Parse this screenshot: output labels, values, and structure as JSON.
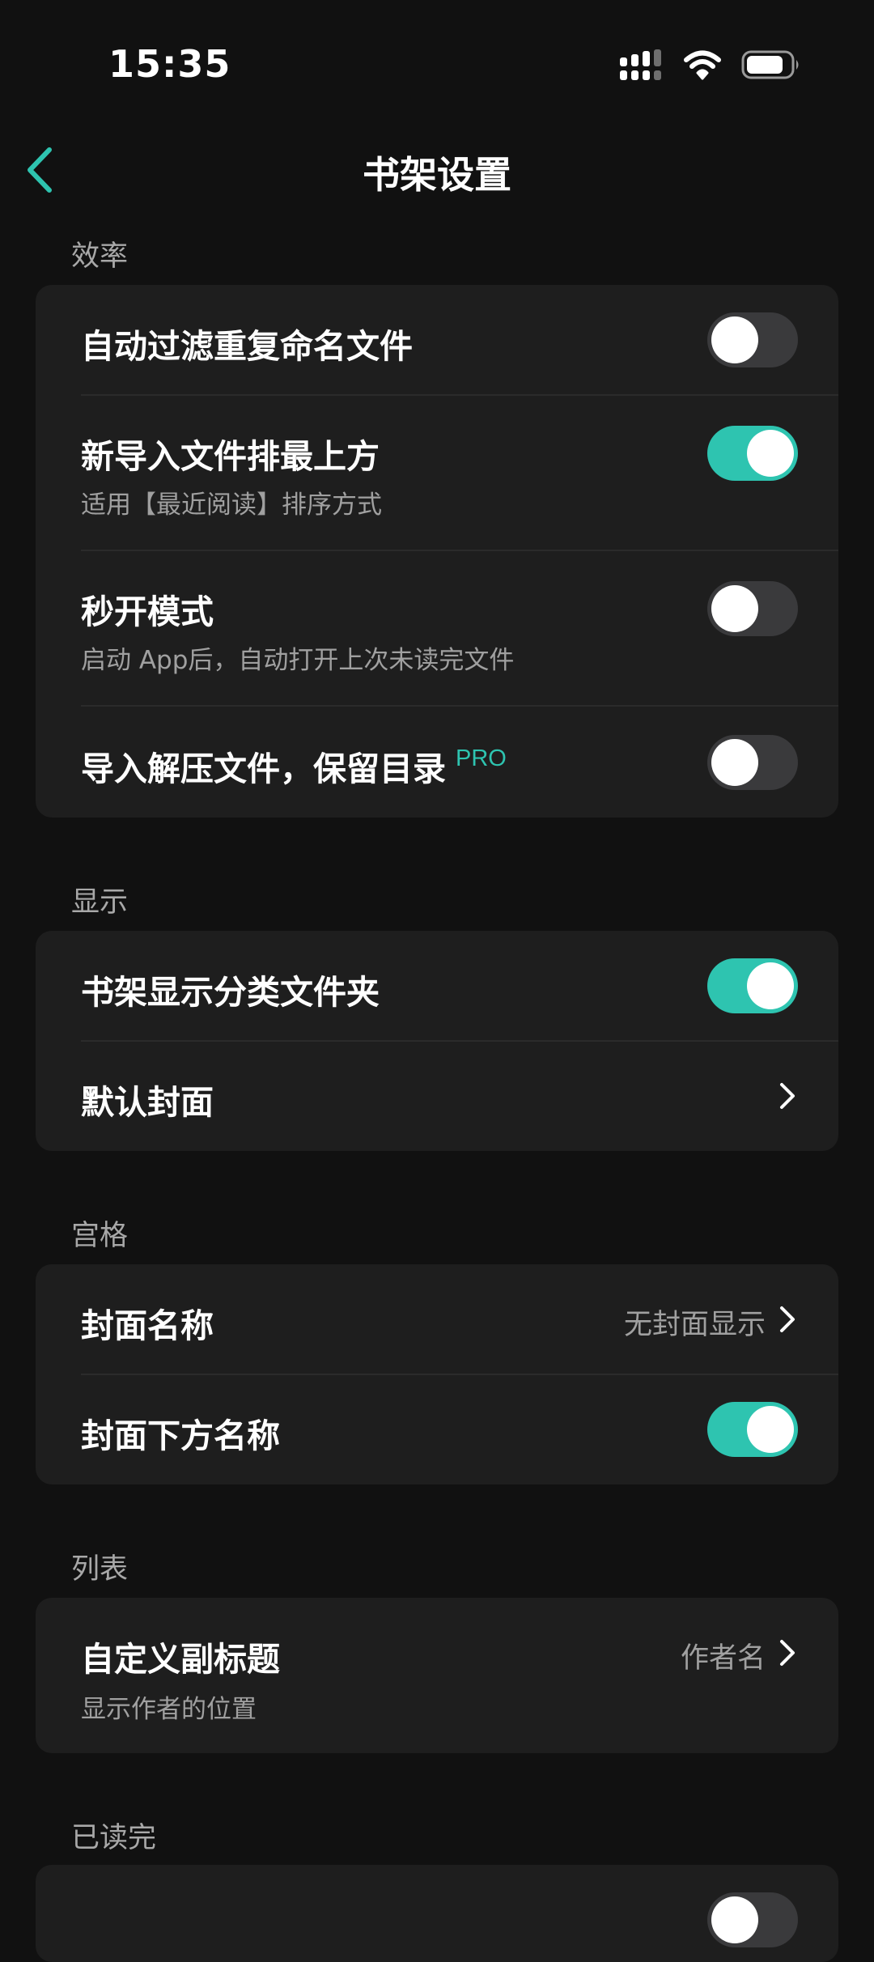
{
  "status_bar": {
    "time": "15:35",
    "icons": [
      "cellular-signal-icon",
      "wifi-icon",
      "battery-icon"
    ]
  },
  "nav": {
    "title": "书架设置",
    "back_icon": "chevron-left-icon"
  },
  "colors": {
    "accent": "#2ec4b0",
    "background": "#111111",
    "card": "#1e1e1e",
    "toggle_off": "#3a3a3c"
  },
  "sections": {
    "efficiency": {
      "header": "效率",
      "rows": [
        {
          "title": "自动过滤重复命名文件",
          "toggle": false
        },
        {
          "title": "新导入文件排最上方",
          "subtitle": "适用【最近阅读】排序方式",
          "toggle": true
        },
        {
          "title": "秒开模式",
          "subtitle": "启动 App后，自动打开上次未读完文件",
          "toggle": false
        },
        {
          "title": "导入解压文件，保留目录",
          "badge": "PRO",
          "toggle": false
        }
      ]
    },
    "display": {
      "header": "显示",
      "rows": [
        {
          "title": "书架显示分类文件夹",
          "toggle": true
        },
        {
          "title": "默认封面"
        }
      ]
    },
    "grid": {
      "header": "宫格",
      "rows": [
        {
          "title": "封面名称",
          "value": "无封面显示"
        },
        {
          "title": "封面下方名称",
          "toggle": true
        }
      ]
    },
    "list": {
      "header": "列表",
      "rows": [
        {
          "title": "自定义副标题",
          "subtitle": "显示作者的位置",
          "value": "作者名"
        }
      ]
    },
    "finished": {
      "header": "已读完"
    }
  }
}
